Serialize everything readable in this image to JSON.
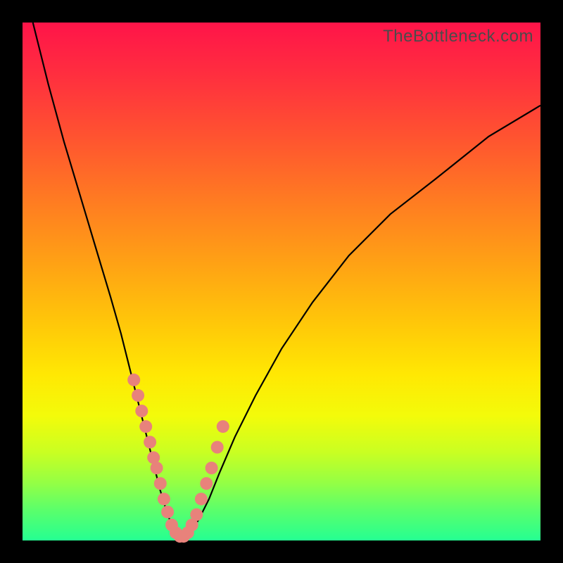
{
  "watermark": "TheBottleneck.com",
  "chart_data": {
    "type": "line",
    "title": "",
    "xlabel": "",
    "ylabel": "",
    "xlim": [
      0,
      100
    ],
    "ylim": [
      0,
      100
    ],
    "series": [
      {
        "name": "bottleneck-curve",
        "x": [
          2,
          5,
          8,
          11,
          14,
          17,
          19,
          21,
          23,
          25,
          26.5,
          28,
          29.5,
          30.8,
          32,
          34,
          36,
          38,
          41,
          45,
          50,
          56,
          63,
          71,
          80,
          90,
          100
        ],
        "values": [
          100,
          88,
          77,
          67,
          57,
          47,
          40,
          32,
          24,
          16,
          10,
          5,
          1.5,
          0.5,
          1,
          4,
          8,
          13,
          20,
          28,
          37,
          46,
          55,
          63,
          70,
          78,
          84
        ]
      }
    ],
    "scatter": {
      "name": "data-points",
      "x": [
        21.5,
        22.3,
        23.0,
        23.8,
        24.6,
        25.3,
        25.9,
        26.6,
        27.3,
        28.0,
        28.8,
        29.6,
        30.4,
        31.1,
        31.9,
        32.7,
        33.6,
        34.5,
        35.5,
        36.5,
        37.6,
        38.7
      ],
      "values": [
        31,
        28,
        25,
        22,
        19,
        16,
        14,
        11,
        8,
        5.5,
        3,
        1.5,
        0.8,
        0.8,
        1.5,
        3,
        5,
        8,
        11,
        14,
        18,
        22
      ]
    }
  }
}
